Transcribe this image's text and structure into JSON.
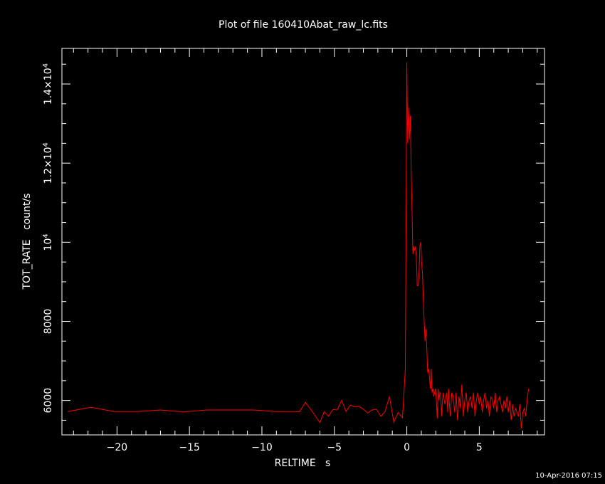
{
  "chart_data": {
    "type": "line",
    "title": "Plot of file 160410Abat_raw_lc.fits",
    "xlabel": "RELTIME   s",
    "ylabel": "TOT_RATE   count/s",
    "timestamp": "10-Apr-2016 07:15",
    "xlim": [
      -23.8,
      9.5
    ],
    "ylim": [
      5130,
      14900
    ],
    "x_ticks": [
      {
        "value": -20,
        "label": "−20"
      },
      {
        "value": -15,
        "label": "−15"
      },
      {
        "value": -10,
        "label": "−10"
      },
      {
        "value": -5,
        "label": "−5"
      },
      {
        "value": 0,
        "label": "0"
      },
      {
        "value": 5,
        "label": "5"
      }
    ],
    "y_ticks": [
      {
        "value": 6000,
        "label": "6000"
      },
      {
        "value": 8000,
        "label": "8000"
      },
      {
        "value": 10000,
        "label": "10",
        "exp": "4"
      },
      {
        "value": 12000,
        "label": "1.2×10",
        "exp": "4"
      },
      {
        "value": 14000,
        "label": "1.4×10",
        "exp": "4"
      }
    ],
    "grid": false,
    "series": [
      {
        "color": "#ff0000",
        "x": [
          -23.4,
          -21.8,
          -20.2,
          -18.6,
          -17.0,
          -15.4,
          -13.8,
          -12.2,
          -10.6,
          -9.0,
          -7.4,
          -7.0,
          -6.6,
          -6.3,
          -6.0,
          -5.7,
          -5.4,
          -5.1,
          -4.8,
          -4.5,
          -4.2,
          -3.9,
          -3.6,
          -3.3,
          -3.0,
          -2.7,
          -2.4,
          -2.1,
          -1.8,
          -1.5,
          -1.2,
          -0.9,
          -0.6,
          -0.3,
          -0.1,
          0.0,
          0.06,
          0.12,
          0.18,
          0.24,
          0.3,
          0.36,
          0.42,
          0.48,
          0.54,
          0.6,
          0.66,
          0.72,
          0.78,
          0.84,
          0.9,
          0.96,
          1.02,
          1.08,
          1.14,
          1.2,
          1.26,
          1.32,
          1.38,
          1.44,
          1.5,
          1.56,
          1.62,
          1.68,
          1.74,
          1.8,
          1.86,
          1.92,
          1.98,
          2.04,
          2.1,
          2.16,
          2.22,
          2.28,
          2.34,
          2.4,
          2.46,
          2.52,
          2.58,
          2.64,
          2.7,
          2.76,
          2.82,
          2.88,
          2.94,
          3.0,
          3.1,
          3.2,
          3.3,
          3.4,
          3.5,
          3.6,
          3.7,
          3.8,
          3.9,
          4.0,
          4.1,
          4.2,
          4.3,
          4.4,
          4.5,
          4.6,
          4.7,
          4.8,
          4.9,
          5.0,
          5.1,
          5.2,
          5.3,
          5.4,
          5.5,
          5.6,
          5.7,
          5.8,
          5.9,
          6.0,
          6.1,
          6.2,
          6.3,
          6.4,
          6.5,
          6.6,
          6.7,
          6.8,
          6.9,
          7.0,
          7.1,
          7.2,
          7.3,
          7.4,
          7.5,
          7.6,
          7.7,
          7.8,
          7.9,
          8.0,
          8.1,
          8.2,
          8.3,
          8.4
        ],
        "y": [
          5720,
          5830,
          5720,
          5720,
          5760,
          5710,
          5760,
          5760,
          5760,
          5720,
          5720,
          5950,
          5760,
          5600,
          5440,
          5720,
          5600,
          5770,
          5760,
          6000,
          5720,
          5880,
          5840,
          5850,
          5780,
          5680,
          5760,
          5780,
          5600,
          5720,
          6100,
          5450,
          5700,
          5560,
          6800,
          14550,
          12500,
          13400,
          12600,
          13200,
          11800,
          10800,
          9700,
          9900,
          9800,
          9900,
          9600,
          8900,
          8900,
          9200,
          9900,
          10000,
          9500,
          9200,
          8500,
          8000,
          7500,
          7800,
          7300,
          6700,
          6800,
          6600,
          6300,
          6800,
          6200,
          6300,
          6100,
          6200,
          6300,
          6000,
          5550,
          6300,
          6000,
          6200,
          6150,
          5600,
          6000,
          6200,
          6000,
          5900,
          6100,
          6200,
          5700,
          6300,
          5900,
          5600,
          6200,
          6100,
          5700,
          6200,
          5500,
          6100,
          5800,
          6400,
          5600,
          6000,
          6200,
          5700,
          6000,
          6100,
          5800,
          6200,
          5600,
          6000,
          6200,
          5900,
          6100,
          5700,
          6000,
          6200,
          5800,
          6000,
          5600,
          6100,
          6000,
          5800,
          6200,
          5700,
          6000,
          6100,
          5900,
          5700,
          6000,
          5800,
          6100,
          5700,
          6000,
          5500,
          5900,
          5600,
          5800,
          5700,
          5600,
          5900,
          5300,
          5700,
          5800,
          5600,
          6000,
          6300
        ]
      }
    ]
  }
}
